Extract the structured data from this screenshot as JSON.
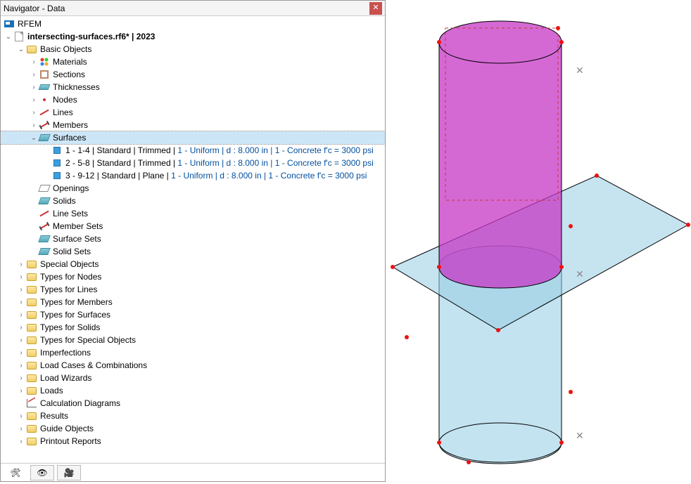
{
  "window": {
    "title": "Navigator - Data"
  },
  "root": {
    "rfem": "RFEM",
    "file": "intersecting-surfaces.rf6* | 2023"
  },
  "basic": {
    "label": "Basic Objects",
    "materials": "Materials",
    "sections": "Sections",
    "thicknesses": "Thicknesses",
    "nodes": "Nodes",
    "lines": "Lines",
    "members": "Members",
    "surfaces": "Surfaces",
    "surfaces_children": [
      {
        "pre": "1 - 1-4 | Standard | Trimmed | ",
        "link": "1 - Uniform | d : 8.000 in | 1 - Concrete f'c = 3000 psi"
      },
      {
        "pre": "2 - 5-8 | Standard | Trimmed | ",
        "link": "1 - Uniform | d : 8.000 in | 1 - Concrete f'c = 3000 psi"
      },
      {
        "pre": "3 - 9-12 | Standard | Plane | ",
        "link": "1 - Uniform | d : 8.000 in | 1 - Concrete f'c = 3000 psi"
      }
    ],
    "openings": "Openings",
    "solids": "Solids",
    "linesets": "Line Sets",
    "membersets": "Member Sets",
    "surfacesets": "Surface Sets",
    "solidsets": "Solid Sets"
  },
  "folders": [
    "Special Objects",
    "Types for Nodes",
    "Types for Lines",
    "Types for Members",
    "Types for Surfaces",
    "Types for Solids",
    "Types for Special Objects",
    "Imperfections",
    "Load Cases & Combinations",
    "Load Wizards",
    "Loads"
  ],
  "calc_diagrams": "Calculation Diagrams",
  "folders2": [
    "Results",
    "Guide Objects",
    "Printout Reports"
  ]
}
